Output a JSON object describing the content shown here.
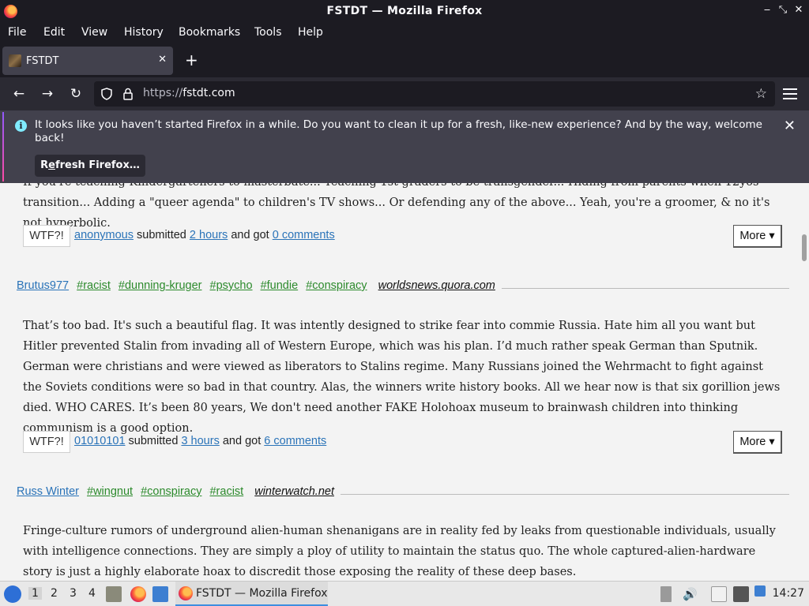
{
  "window": {
    "title": "FSTDT — Mozilla Firefox"
  },
  "menu": [
    "File",
    "Edit",
    "View",
    "History",
    "Bookmarks",
    "Tools",
    "Help"
  ],
  "tab": {
    "title": "FSTDT"
  },
  "urlbar": {
    "scheme": "https://",
    "host": "fstdt.com"
  },
  "notification": {
    "message": "It looks like you haven’t started Firefox in a while. Do you want to clean it up for a fresh, like-new experience? And by the way, welcome back!",
    "button_prefix": "R",
    "button_accel": "e",
    "button_rest": "fresh Firefox…"
  },
  "posts": [
    {
      "text": "If you're teaching Kindergarteners to masterbate... Teaching 1st graders to be transgender... Hiding from parents when 12yos transition... Adding a \"queer agenda\" to children's TV shows... Or defending any of the above... Yeah, you're a groomer, & no it's not hyperbolic.",
      "wtf": "WTF?!",
      "submitter": "anonymous",
      "submitted_word": "submitted",
      "time": "2 hours",
      "got_word": "and got",
      "comments": "0 comments",
      "more": "More ▾"
    },
    {
      "author": "Brutus977",
      "tags": [
        "#racist",
        "#dunning-kruger",
        "#psycho",
        "#fundie",
        "#conspiracy"
      ],
      "source": "worldsnews.quora.com",
      "text": "That’s too bad. It's such a beautiful flag. It was intently designed to strike fear into commie Russia. Hate him all you want but Hitler prevented Stalin from invading all of Western Europe, which was his plan. I’d much rather speak German than Sputnik. German were christians and were viewed as liberators to Stalins regime. Many Russians joined the Wehrmacht to fight against the Soviets conditions were so bad in that country. Alas, the winners write history books. All we hear now is that six gorillion jews died. WHO CARES. It’s been 80 years, We don't need another FAKE Holohoax museum to brainwash children into thinking communism is a good option.",
      "wtf": "WTF?!",
      "submitter": "01010101",
      "submitted_word": "submitted",
      "time": "3 hours",
      "got_word": "and got",
      "comments": "6 comments",
      "more": "More ▾"
    },
    {
      "author": "Russ Winter",
      "tags": [
        "#wingnut",
        "#conspiracy",
        "#racist"
      ],
      "source": "winterwatch.net",
      "text": "Fringe-culture rumors of underground alien-human shenanigans are in reality fed by leaks from questionable individuals, usually with intelligence connections. They are simply a ploy of utility to maintain the status quo. The whole captured-alien-hardware story is just a highly elaborate hoax to discredit those exposing the reality of these deep bases."
    }
  ],
  "taskbar": {
    "workspaces": [
      "1",
      "2",
      "3",
      "4"
    ],
    "task_label": "FSTDT — Mozilla Firefox",
    "clock": "14:27"
  }
}
